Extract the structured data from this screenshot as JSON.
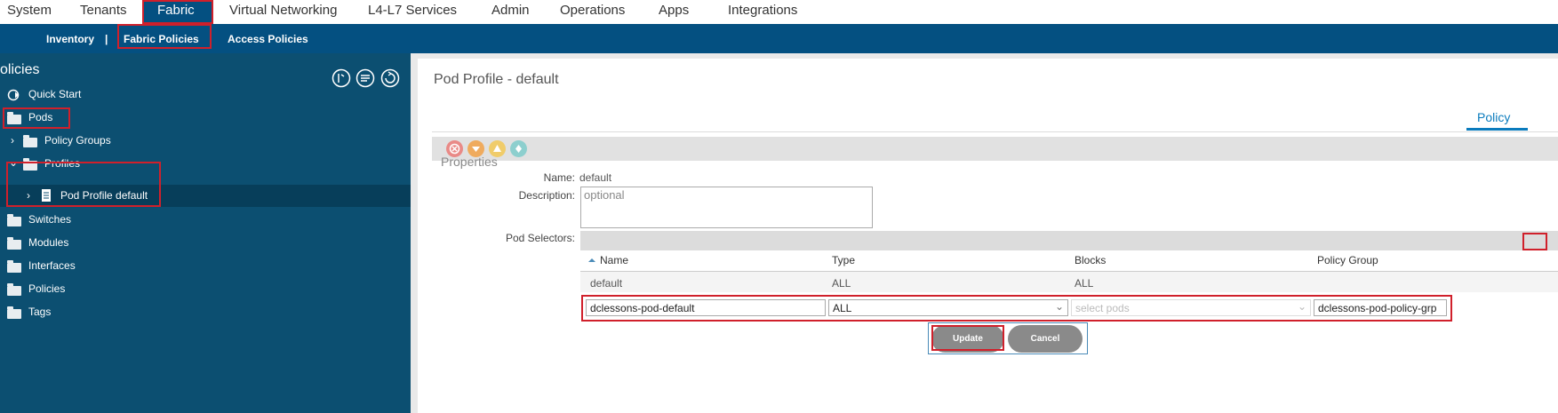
{
  "top_nav": {
    "items": [
      "System",
      "Tenants",
      "Fabric",
      "Virtual Networking",
      "L4-L7 Services",
      "Admin",
      "Operations",
      "Apps",
      "Integrations"
    ],
    "active": "Fabric"
  },
  "sub_nav": {
    "items": [
      "Inventory",
      "|",
      "Fabric Policies",
      "Access Policies"
    ],
    "active": "Fabric Policies"
  },
  "sidebar": {
    "title": "olicies",
    "tree": [
      {
        "label": "Quick Start",
        "icon": "quick-start-icon"
      },
      {
        "label": "Pods",
        "icon": "folder-icon"
      },
      {
        "label": "Policy Groups",
        "icon": "folder-icon"
      },
      {
        "label": "Profiles",
        "icon": "folder-icon"
      },
      {
        "label": "Pod Profile default",
        "icon": "document-icon"
      },
      {
        "label": "Switches",
        "icon": "folder-icon"
      },
      {
        "label": "Modules",
        "icon": "folder-icon"
      },
      {
        "label": "Interfaces",
        "icon": "folder-icon"
      },
      {
        "label": "Policies",
        "icon": "folder-icon"
      },
      {
        "label": "Tags",
        "icon": "folder-icon"
      }
    ]
  },
  "main": {
    "title": "Pod Profile - default",
    "tab": "Policy",
    "section": "Properties",
    "name_label": "Name:",
    "name_value": "default",
    "description_label": "Description:",
    "description_placeholder": "optional",
    "pod_selectors_label": "Pod Selectors:",
    "table": {
      "columns": [
        "Name",
        "Type",
        "Blocks",
        "Policy Group"
      ],
      "row": [
        "default",
        "ALL",
        "ALL",
        ""
      ],
      "edit_row": {
        "name": "dclessons-pod-default",
        "type": "ALL",
        "blocks_placeholder": "select pods",
        "policy_group": "dclessons-pod-policy-grp"
      }
    },
    "update_label": "Update",
    "cancel_label": "Cancel"
  },
  "colors": {
    "subnav_bg": "#045081",
    "sidebar_bg": "#0c4f71",
    "highlight": "#d0202b",
    "tab_underline": "#0a7bbd"
  }
}
